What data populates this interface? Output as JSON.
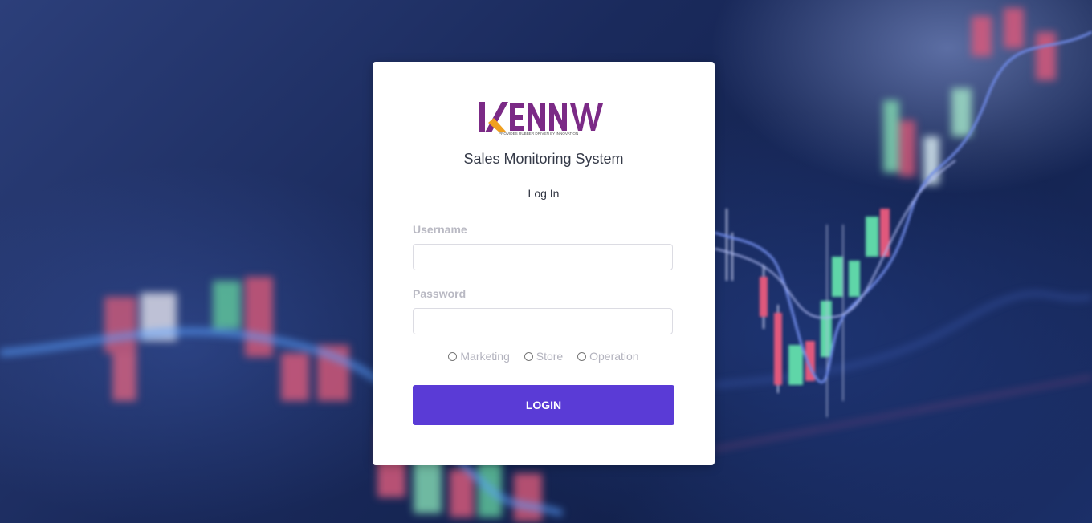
{
  "brand": {
    "logo_text": "KENNWU",
    "tagline": "PROVIDES RUBBER DRIVEN BY INNOVATION",
    "logo_color": "#7b2a86"
  },
  "page": {
    "title": "Sales Monitoring System",
    "subtitle": "Log In"
  },
  "form": {
    "username_label": "Username",
    "username_value": "",
    "password_label": "Password",
    "password_value": "",
    "roles": [
      {
        "label": "Marketing",
        "selected": false
      },
      {
        "label": "Store",
        "selected": false
      },
      {
        "label": "Operation",
        "selected": false
      }
    ],
    "login_label": "LOGIN"
  },
  "colors": {
    "accent": "#5a3bd6",
    "label": "#b9b9c3"
  }
}
